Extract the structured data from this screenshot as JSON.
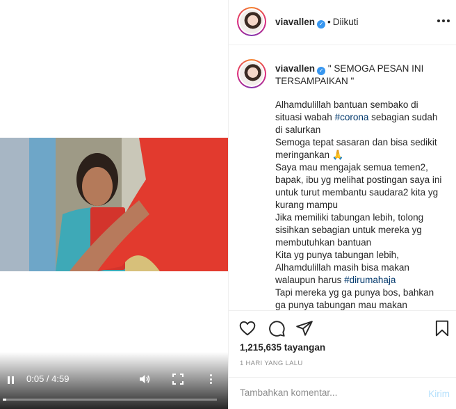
{
  "video": {
    "time": "0:05 / 4:59",
    "progress_fraction": 0.017
  },
  "header": {
    "username": "viavallen",
    "separator": "•",
    "follow_status": "Diikuti"
  },
  "caption": {
    "username": "viavallen",
    "title": "\" SEMOGA PESAN INI TERSAMPAIKAN \"",
    "lines": [
      "Alhamdulillah bantuan sembako di situasi wabah ",
      "Semoga tepat sasaran dan bisa sedikit meringankan 🙏",
      "Saya mau mengajak semua temen2, bapak, ibu yg melihat postingan saya ini untuk turut membantu saudara2 kita yg kurang mampu",
      "Jika memiliki tabungan lebih, tolong sisihkan sebagian untuk mereka yg membutuhkan bantuan",
      "Kita yg punya tabungan lebih, Alhamdulillah masih bisa makan walaupun harus ",
      "Tapi mereka yg ga punya bos, bahkan ga punya tabungan mau makan"
    ],
    "hashtag_corona": "#corona",
    "after_corona": " sebagian sudah di salurkan",
    "hashtag_dirumahaja": "#dirumahaja"
  },
  "actions": {
    "views": "1,215,635 tayangan",
    "time_ago": "1 HARI YANG LALU"
  },
  "comment": {
    "placeholder": "Tambahkan komentar...",
    "post_label": "Kirim"
  },
  "colors": {
    "verified": "#3897f0",
    "hashtag": "#00376b",
    "post_disabled": "#b2dffc"
  }
}
